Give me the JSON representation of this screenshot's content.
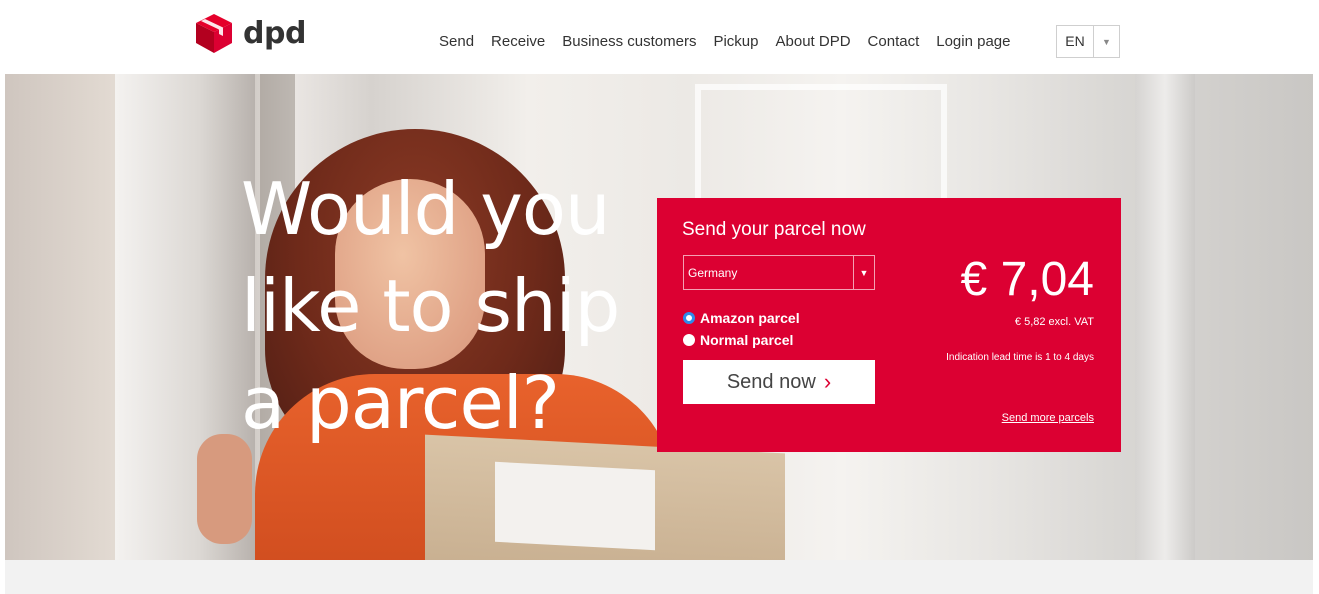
{
  "brand": {
    "name": "dpd",
    "color": "#dc0032"
  },
  "nav": {
    "items": [
      {
        "label": "Send"
      },
      {
        "label": "Receive"
      },
      {
        "label": "Business customers"
      },
      {
        "label": "Pickup"
      },
      {
        "label": "About DPD"
      },
      {
        "label": "Contact"
      },
      {
        "label": "Login page"
      }
    ],
    "language": {
      "value": "EN",
      "icon": "chevron-down-icon"
    }
  },
  "hero": {
    "headline": [
      "Would you",
      "like to ship",
      "a parcel?"
    ]
  },
  "send_box": {
    "title": "Send your parcel now",
    "country": "Germany",
    "parcel_types": [
      {
        "label": "Amazon parcel",
        "checked": true
      },
      {
        "label": "Normal parcel",
        "checked": false
      }
    ],
    "button_label": "Send now",
    "price": "€ 7,04",
    "price_excl_vat": "€ 5,82 excl. VAT",
    "lead_time": "Indication lead time is 1 to 4 days",
    "more_link": "Send more parcels"
  }
}
